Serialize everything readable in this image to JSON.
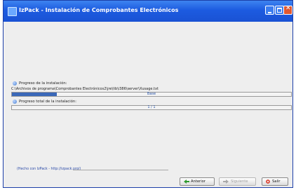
{
  "window": {
    "title": "IzPack - Instalación de Comprobantes Electrónicos"
  },
  "install": {
    "progress_label": "Progreso de la instalación:",
    "current_file": "C:\\Archivos de programa\\Comprobantes Electrónicos2\\jre\\lib\\i386\\server\\Xusage.txt",
    "pack_bar_text": "Base",
    "pack_progress": 0.16,
    "overall_label": "Progreso total de la instalación:",
    "overall_bar_text": "1 / 1",
    "overall_progress": 0
  },
  "footer": {
    "credit": "(Hecho con IzPack - http://izpack.org/)",
    "back_label": "Anterior",
    "next_label": "Siguiente",
    "quit_label": "Salir"
  },
  "colors": {
    "accent": "#1c5be0",
    "progress_fill": "#3a68b8"
  },
  "icons": {
    "back": "green-left-arrow-icon",
    "next": "gray-right-arrow-icon",
    "quit": "red-circle-x-icon"
  }
}
